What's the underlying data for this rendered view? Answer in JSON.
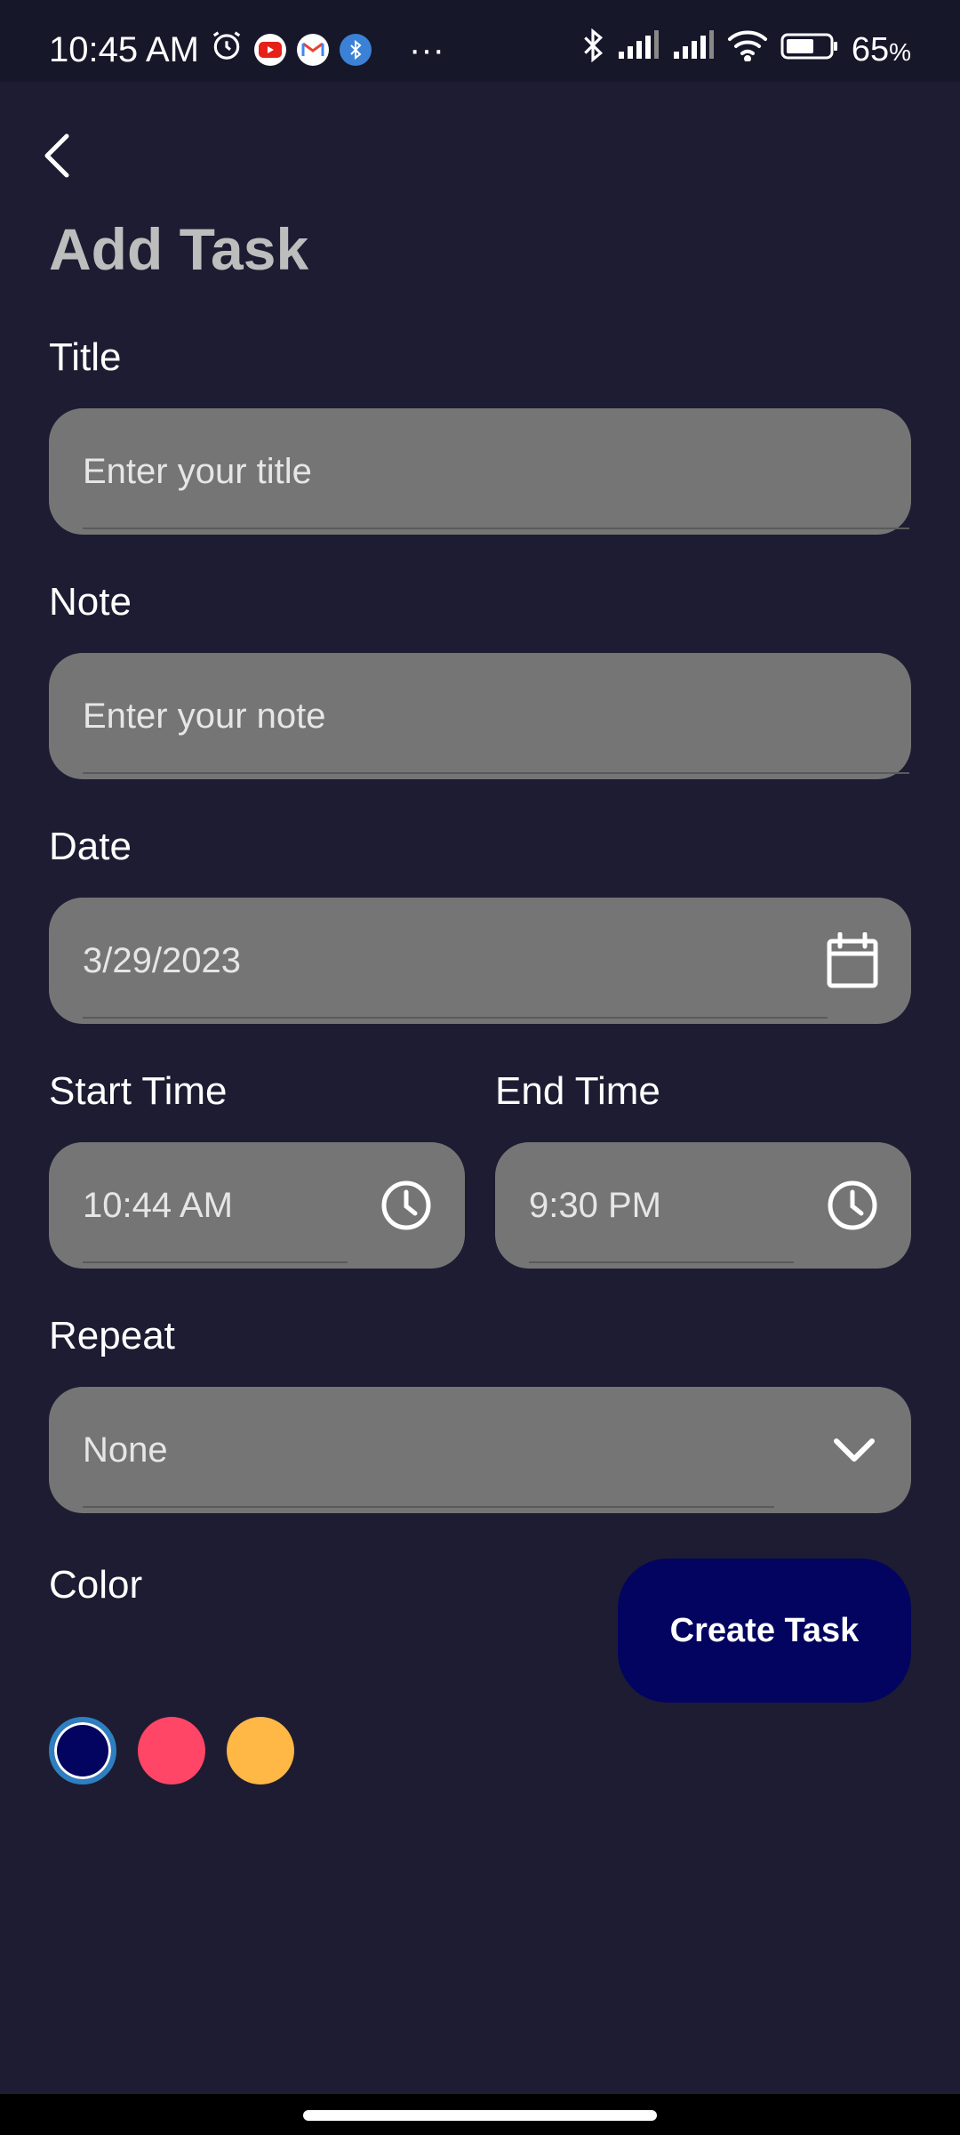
{
  "status_bar": {
    "time": "10:45 AM",
    "more": "···",
    "battery_percent": "65",
    "battery_unit": "%"
  },
  "page": {
    "title": "Add Task"
  },
  "form": {
    "title": {
      "label": "Title",
      "placeholder": "Enter your title"
    },
    "note": {
      "label": "Note",
      "placeholder": "Enter your note"
    },
    "date": {
      "label": "Date",
      "value": "3/29/2023"
    },
    "start_time": {
      "label": "Start Time",
      "value": "10:44 AM"
    },
    "end_time": {
      "label": "End Time",
      "value": "9:30 PM"
    },
    "repeat": {
      "label": "Repeat",
      "value": "None"
    }
  },
  "color": {
    "label": "Color",
    "options": [
      "#020460",
      "#ff4667",
      "#ffb746"
    ],
    "selected_index": 0,
    "ring_color": "#2e7fc1"
  },
  "actions": {
    "create_label": "Create Task"
  }
}
